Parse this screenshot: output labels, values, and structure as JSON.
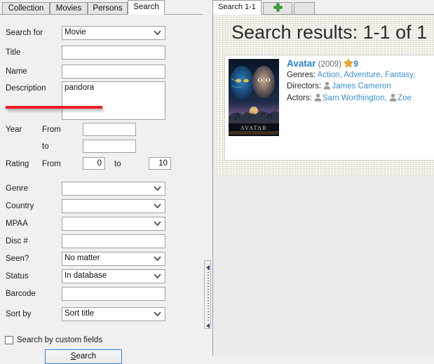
{
  "left_tabs": [
    {
      "label": "Collection",
      "active": false
    },
    {
      "label": "Movies",
      "active": false
    },
    {
      "label": "Persons",
      "active": false
    },
    {
      "label": "Search",
      "active": true
    }
  ],
  "form": {
    "search_for": {
      "label": "Search for",
      "value": "Movie"
    },
    "title": {
      "label": "Title",
      "value": ""
    },
    "name": {
      "label": "Name",
      "value": ""
    },
    "description": {
      "label": "Description",
      "value": "pandora"
    },
    "year": {
      "label": "Year",
      "from_label": "From",
      "from_value": "",
      "to_label": "to",
      "to_value": ""
    },
    "rating": {
      "label": "Rating",
      "from_label": "From",
      "from_value": "0",
      "to_label": "to",
      "to_value": "10"
    },
    "genre": {
      "label": "Genre",
      "value": ""
    },
    "country": {
      "label": "Country",
      "value": ""
    },
    "mpaa": {
      "label": "MPAA",
      "value": ""
    },
    "disc": {
      "label": "Disc #",
      "value": ""
    },
    "seen": {
      "label": "Seen?",
      "value": "No matter"
    },
    "status": {
      "label": "Status",
      "value": "In database"
    },
    "barcode": {
      "label": "Barcode",
      "value": ""
    },
    "sort_by": {
      "label": "Sort by",
      "value": "Sort title"
    },
    "custom_fields": {
      "label": "Search by custom fields",
      "checked": false
    },
    "search_button": {
      "accel": "S",
      "rest": "earch"
    }
  },
  "right_tabs": [
    {
      "label": "Search 1-1",
      "active": true
    },
    {
      "label": "",
      "icon": "plus-icon",
      "active": false
    }
  ],
  "results": {
    "heading": "Search results: 1-1 of 1",
    "movie": {
      "title": "Avatar",
      "year": "(2009)",
      "rating": "9",
      "genres_label": "Genres:",
      "genres": "Action, Adventure, Fantasy,",
      "directors_label": "Directors:",
      "directors": "James Cameron",
      "actors_label": "Actors:",
      "actor_1": "Sam Worthington,",
      "actor_2": "Zoe",
      "poster_caption": "AVATAR"
    }
  },
  "colors": {
    "accent_link": "#3a8fd4",
    "title_link": "#2a7fc9",
    "annotation_red": "#ed1c24",
    "star_orange": "#f5a623",
    "focus_blue": "#2c80d3"
  }
}
